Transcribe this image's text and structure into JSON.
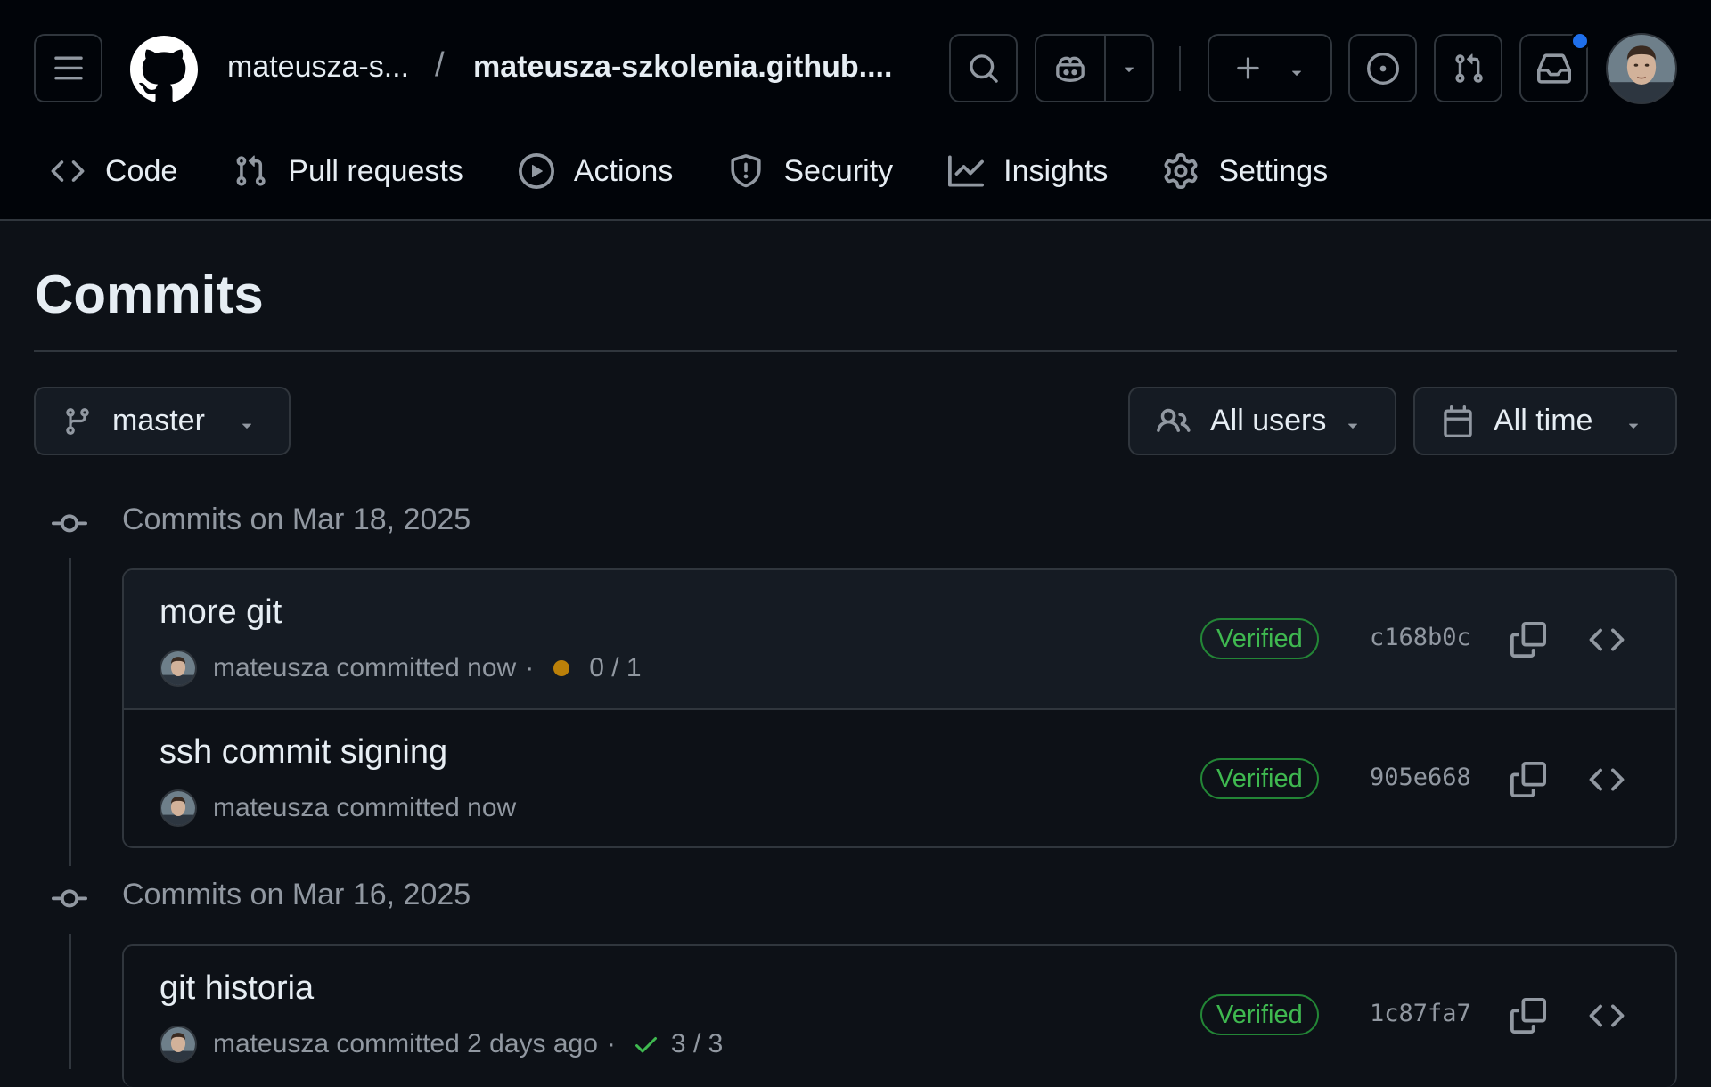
{
  "header": {
    "owner": "mateusza-s...",
    "separator": "/",
    "repo": "mateusza-szkolenia.github...."
  },
  "nav": {
    "tabs": [
      {
        "label": "Code",
        "icon": "code-icon"
      },
      {
        "label": "Pull requests",
        "icon": "git-pull-request-icon"
      },
      {
        "label": "Actions",
        "icon": "play-icon"
      },
      {
        "label": "Security",
        "icon": "shield-icon"
      },
      {
        "label": "Insights",
        "icon": "graph-icon"
      },
      {
        "label": "Settings",
        "icon": "gear-icon"
      }
    ]
  },
  "page": {
    "title": "Commits"
  },
  "filters": {
    "branch": "master",
    "users": "All users",
    "time": "All time"
  },
  "groups": [
    {
      "heading": "Commits on Mar 18, 2025",
      "commits": [
        {
          "title": "more git",
          "author": "mateusza",
          "action": "committed",
          "time": "now",
          "checks": "0 / 1",
          "checks_status": "pending",
          "badge": "Verified",
          "sha": "c168b0c"
        },
        {
          "title": "ssh commit signing",
          "author": "mateusza",
          "action": "committed",
          "time": "now",
          "badge": "Verified",
          "sha": "905e668"
        }
      ]
    },
    {
      "heading": "Commits on Mar 16, 2025",
      "commits": [
        {
          "title": "git historia",
          "author": "mateusza",
          "action": "committed",
          "time": "2 days ago",
          "checks": "3 / 3",
          "checks_status": "success",
          "badge": "Verified",
          "sha": "1c87fa7"
        }
      ]
    }
  ],
  "colors": {
    "background": "#0d1117",
    "header_background": "#010409",
    "border": "#30363d",
    "verified_green": "#3fb950",
    "pending_dot": "#bb8009",
    "notification_dot": "#1f6feb"
  }
}
